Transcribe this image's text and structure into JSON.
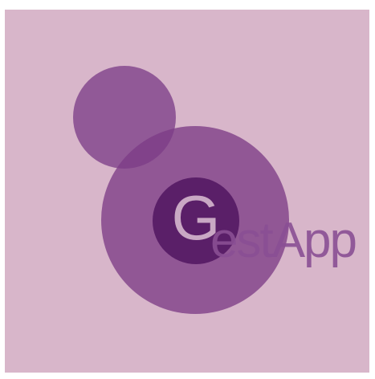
{
  "logo": {
    "wordmark_initial": "G",
    "wordmark_rest": "estApp",
    "colors": {
      "background": "#d8b6ca",
      "small_circle": "#7a3a85",
      "large_circle": "#7c3c87",
      "g_ring": "#5a1f68",
      "g_letter": "#c9a8c4",
      "wordmark_text": "#8a4f93"
    }
  }
}
